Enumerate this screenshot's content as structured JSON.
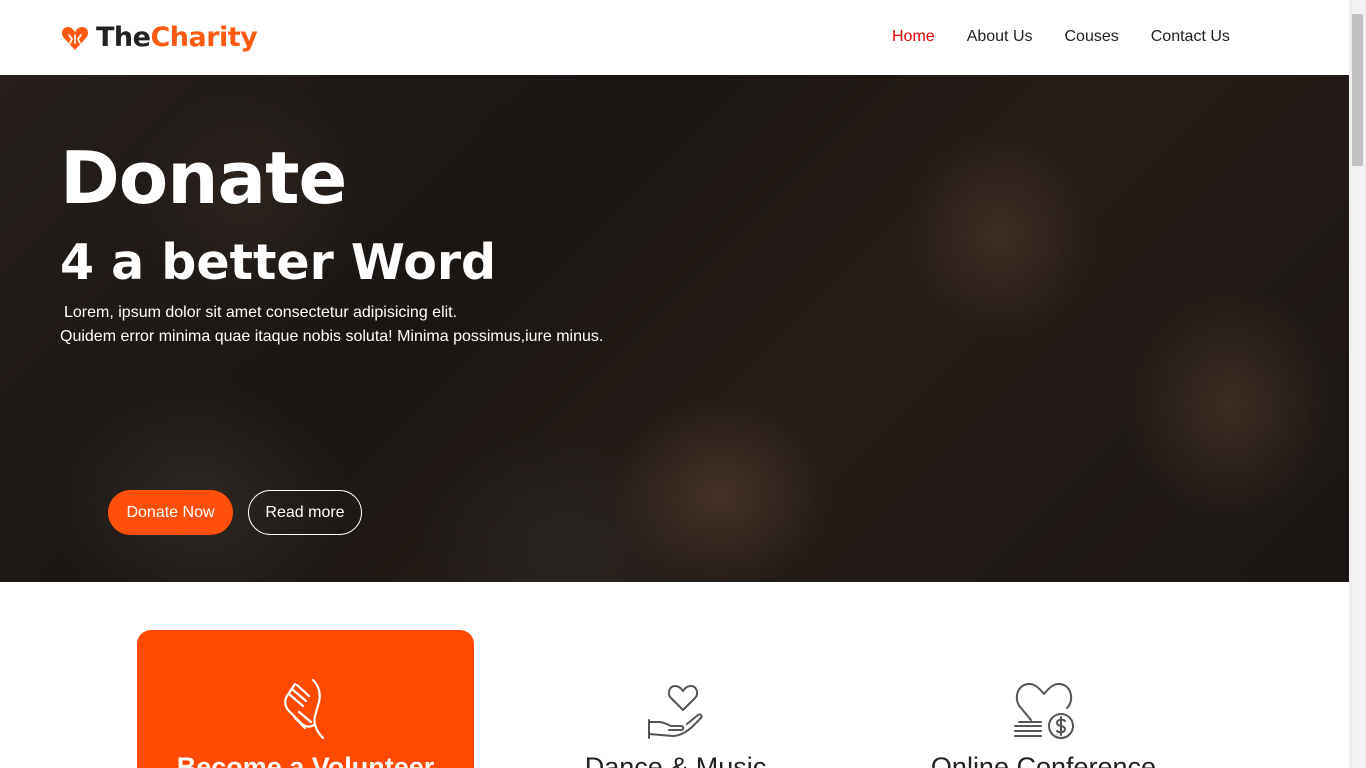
{
  "header": {
    "logo": {
      "part1": "The",
      "part2": "Charity",
      "icon": "heart-hands-icon"
    },
    "nav": [
      {
        "label": "Home",
        "active": true
      },
      {
        "label": "About Us",
        "active": false
      },
      {
        "label": "Couses",
        "active": false
      },
      {
        "label": "Contact Us",
        "active": false
      }
    ]
  },
  "hero": {
    "title": "Donate",
    "subtitle": "4 a better Word",
    "text_line1": "Lorem, ipsum dolor sit amet consectetur adipisicing elit.",
    "text_line2": "Quidem error minima quae itaque nobis soluta! Minima possimus,iure minus.",
    "donate_button": "Donate Now",
    "read_button": "Read more"
  },
  "services": [
    {
      "title": "Become a Volunteer",
      "icon": "helping-hands-icon",
      "highlighted": true
    },
    {
      "title": "Dance & Music",
      "icon": "heart-in-hand-icon",
      "highlighted": false
    },
    {
      "title": "Online Conference",
      "icon": "heart-donation-icon",
      "highlighted": false
    }
  ],
  "colors": {
    "accent": "#ff4a00",
    "nav_active": "#e00000",
    "text_dark": "#222222"
  }
}
